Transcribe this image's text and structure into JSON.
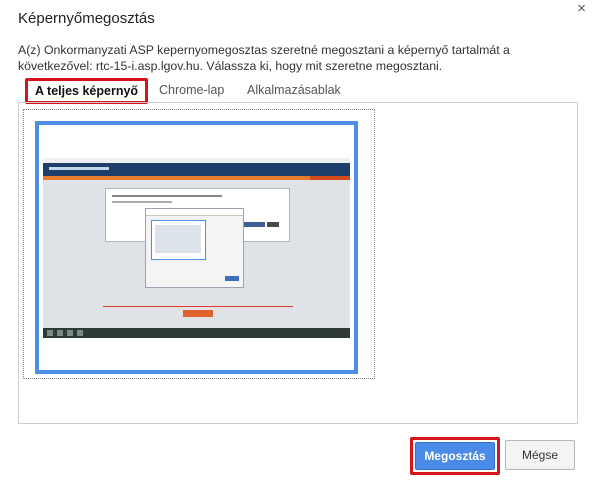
{
  "dialog": {
    "title": "Képernyőmegosztás",
    "close_glyph": "×",
    "description": "A(z) Onkormanyzati ASP kepernyomegosztas szeretné megosztani a képernyő tartalmát a következővel: rtc-15-i.asp.lgov.hu. Válassza ki, hogy mit szeretne megosztani."
  },
  "tabs": [
    {
      "label": "A teljes képernyő",
      "selected": true
    },
    {
      "label": "Chrome-lap",
      "selected": false
    },
    {
      "label": "Alkalmazásablak",
      "selected": false
    }
  ],
  "buttons": {
    "share_label": "Megosztás",
    "cancel_label": "Mégse"
  },
  "colors": {
    "accent_blue": "#4a8ae8",
    "highlight_red": "#d4141c",
    "selection_blue": "#4e8fe6"
  },
  "icons": {
    "close": "close-icon"
  }
}
